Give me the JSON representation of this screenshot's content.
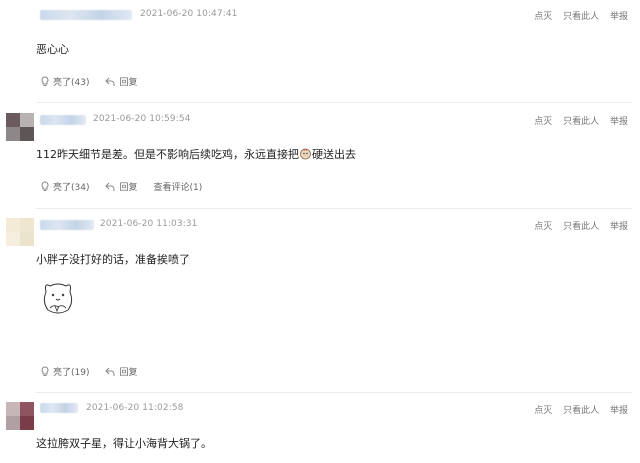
{
  "comments": [
    {
      "time": "2021-06-20 10:47:41",
      "text": "恶心心",
      "like_label": "亮了(43)",
      "reply_label": "回复"
    },
    {
      "time": "2021-06-20 10:59:54",
      "text_before": "112昨天细节是差。但是不影响后续吃鸡，永远直接把",
      "text_after": "硬送出去",
      "like_label": "亮了(34)",
      "reply_label": "回复",
      "view_replies_label": "查看评论(1)"
    },
    {
      "time": "2021-06-20 11:03:31",
      "text": "小胖子没打好的话，准备挨喷了",
      "like_label": "亮了(19)",
      "reply_label": "回复"
    },
    {
      "time": "2021-06-20 11:02:58",
      "text": "这拉胯双子星，得让小海背大锅了。"
    }
  ],
  "actions": {
    "light_off": "点灭",
    "only_this": "只看此人",
    "report": "举报"
  },
  "colors": {
    "text": "#222222",
    "meta": "#9a9a9a",
    "divider": "#ececec"
  }
}
